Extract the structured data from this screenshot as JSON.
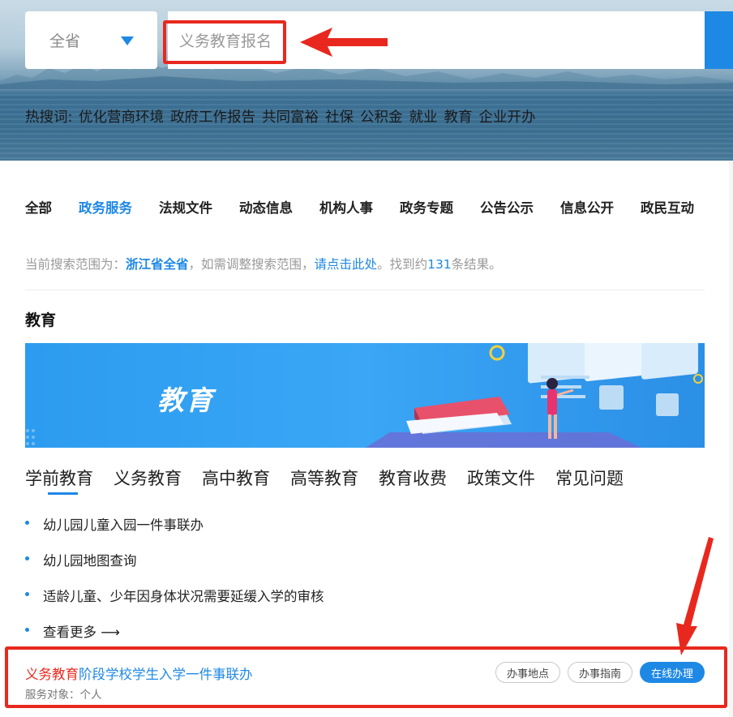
{
  "search": {
    "region": "全省",
    "query": "义务教育报名",
    "hot_label": "热搜词:",
    "hot_words": [
      "优化营商环境",
      "政府工作报告",
      "共同富裕",
      "社保",
      "公积金",
      "就业",
      "教育",
      "企业开办"
    ]
  },
  "tabs": [
    "全部",
    "政务服务",
    "法规文件",
    "动态信息",
    "机构人事",
    "政务专题",
    "公告公示",
    "信息公开",
    "政民互动"
  ],
  "active_tab": "政务服务",
  "scope": {
    "prefix": "当前搜索范围为：",
    "region": "浙江省全省",
    "middle": "，如需调整搜索范围，",
    "link": "请点击此处",
    "suffix_pre": "。找到约",
    "count": "131",
    "suffix_post": "条结果。"
  },
  "section": {
    "title": "教育",
    "banner_word": "教育",
    "subtabs": [
      "学前教育",
      "义务教育",
      "高中教育",
      "高等教育",
      "教育收费",
      "政策文件",
      "常见问题"
    ],
    "items": [
      "幼儿园儿童入园一件事联办",
      "幼儿园地图查询",
      "适龄儿童、少年因身体状况需要延缓入学的审核"
    ],
    "more": "查看更多 ⟶"
  },
  "result": {
    "title_highlight": "义务教育",
    "title_rest": "阶段学校学生入学一件事联办",
    "meta": "服务对象：个人",
    "btn_location": "办事地点",
    "btn_guide": "办事指南",
    "btn_online": "在线办理"
  },
  "colors": {
    "accent": "#1e88e5",
    "annotation_red": "#e8281e"
  },
  "icons": [
    "dropdown-caret-icon",
    "annotation-arrow-icon",
    "bullet-dot-icon"
  ]
}
